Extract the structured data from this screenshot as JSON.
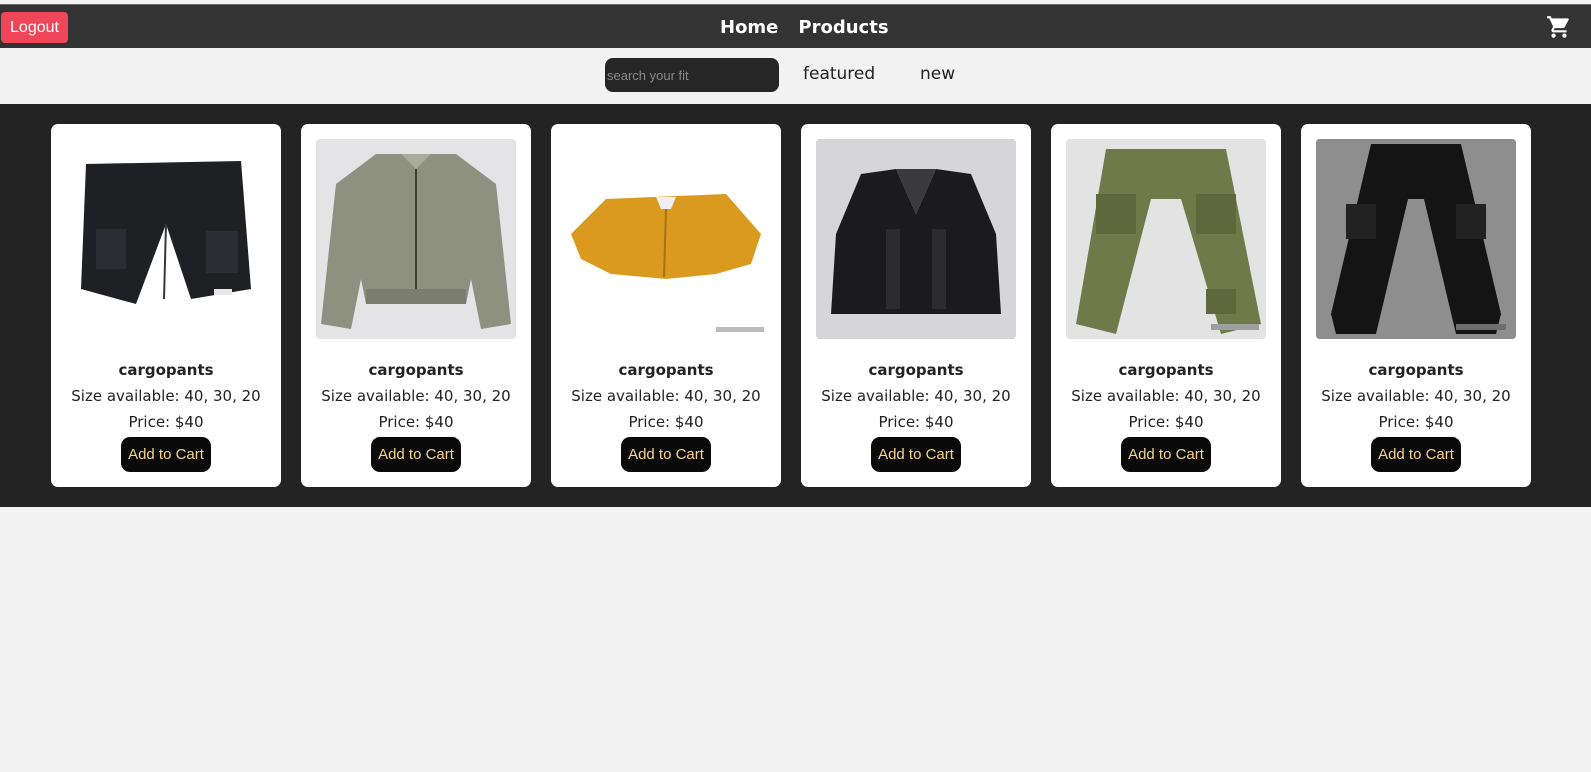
{
  "navbar": {
    "logout_label": "Logout",
    "links": [
      "Home",
      "Products"
    ],
    "cart_icon": "shopping-cart-icon"
  },
  "subbar": {
    "search_placeholder": "search your fit",
    "filters": [
      "featured",
      "new"
    ]
  },
  "products": [
    {
      "name": "cargopants",
      "sizes": "Size available: 40, 30, 20",
      "price": "Price: $40",
      "button": "Add to Cart",
      "image": "black cargo shorts"
    },
    {
      "name": "cargopants",
      "sizes": "Size available: 40, 30, 20",
      "price": "Price: $40",
      "button": "Add to Cart",
      "image": "olive zip jacket"
    },
    {
      "name": "cargopants",
      "sizes": "Size available: 40, 30, 20",
      "price": "Price: $40",
      "button": "Add to Cart",
      "image": "orange button shirt"
    },
    {
      "name": "cargopants",
      "sizes": "Size available: 40, 30, 20",
      "price": "Price: $40",
      "button": "Add to Cart",
      "image": "black tactical vest"
    },
    {
      "name": "cargopants",
      "sizes": "Size available: 40, 30, 20",
      "price": "Price: $40",
      "button": "Add to Cart",
      "image": "olive cargo pants"
    },
    {
      "name": "cargopants",
      "sizes": "Size available: 40, 30, 20",
      "price": "Price: $40",
      "button": "Add to Cart",
      "image": "black jogger cargo pants"
    }
  ],
  "colors": {
    "navbar": "#333333",
    "logout": "#f0465a",
    "grid_background": "#232323",
    "button_text": "#f7d38b"
  }
}
